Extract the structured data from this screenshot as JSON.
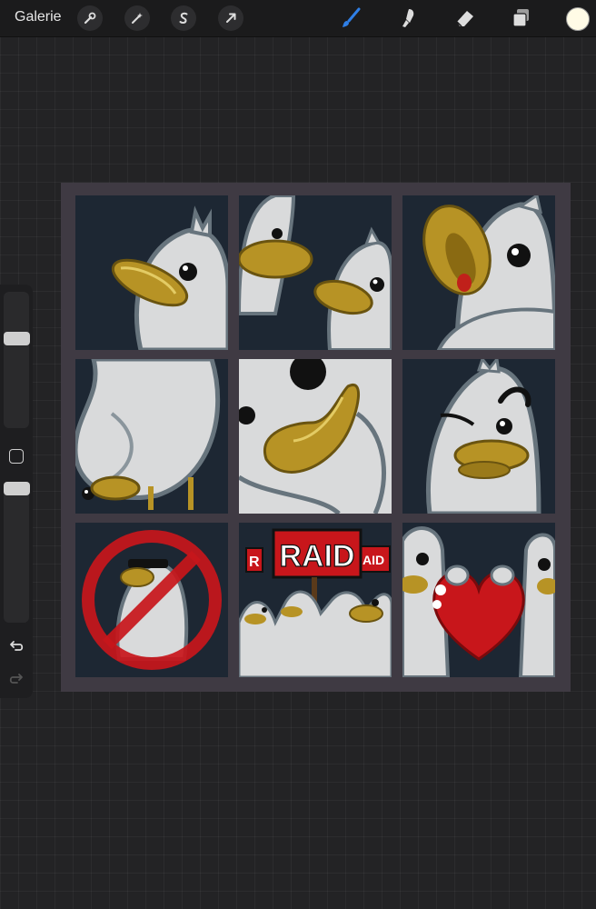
{
  "toolbar": {
    "gallery_label": "Galerie",
    "left_tools": [
      {
        "name": "actions-wrench-icon"
      },
      {
        "name": "adjustments-wand-icon"
      },
      {
        "name": "selection-s-icon"
      },
      {
        "name": "transform-arrow-icon"
      }
    ],
    "right_tools": [
      {
        "name": "brush-icon",
        "active": true
      },
      {
        "name": "smudge-icon"
      },
      {
        "name": "eraser-icon"
      },
      {
        "name": "layers-icon"
      }
    ],
    "current_color": "#fffbe6",
    "active_color": "#2f7fe6"
  },
  "sidebar": {
    "brush_size_level": 0.38,
    "brush_opacity_level": 0.1,
    "undo_icon": "undo-icon",
    "redo_icon": "redo-icon"
  },
  "artwork": {
    "panels": [
      {
        "id": "duck-peek"
      },
      {
        "id": "two-ducks"
      },
      {
        "id": "duck-shout"
      },
      {
        "id": "duck-body"
      },
      {
        "id": "duck-beak-closeup"
      },
      {
        "id": "duck-angry"
      },
      {
        "id": "no-duck"
      },
      {
        "id": "raid-crowd"
      },
      {
        "id": "duck-heart"
      }
    ],
    "raid_sign_text": "RAID",
    "raid_side_left": "R",
    "raid_side_right": "AID",
    "colors": {
      "background": "#1d2733",
      "duck_body": "#d9dadb",
      "duck_outline": "#67747d",
      "beak": "#b79325",
      "frame": "#3f3a43",
      "red": "#c8161b"
    }
  }
}
